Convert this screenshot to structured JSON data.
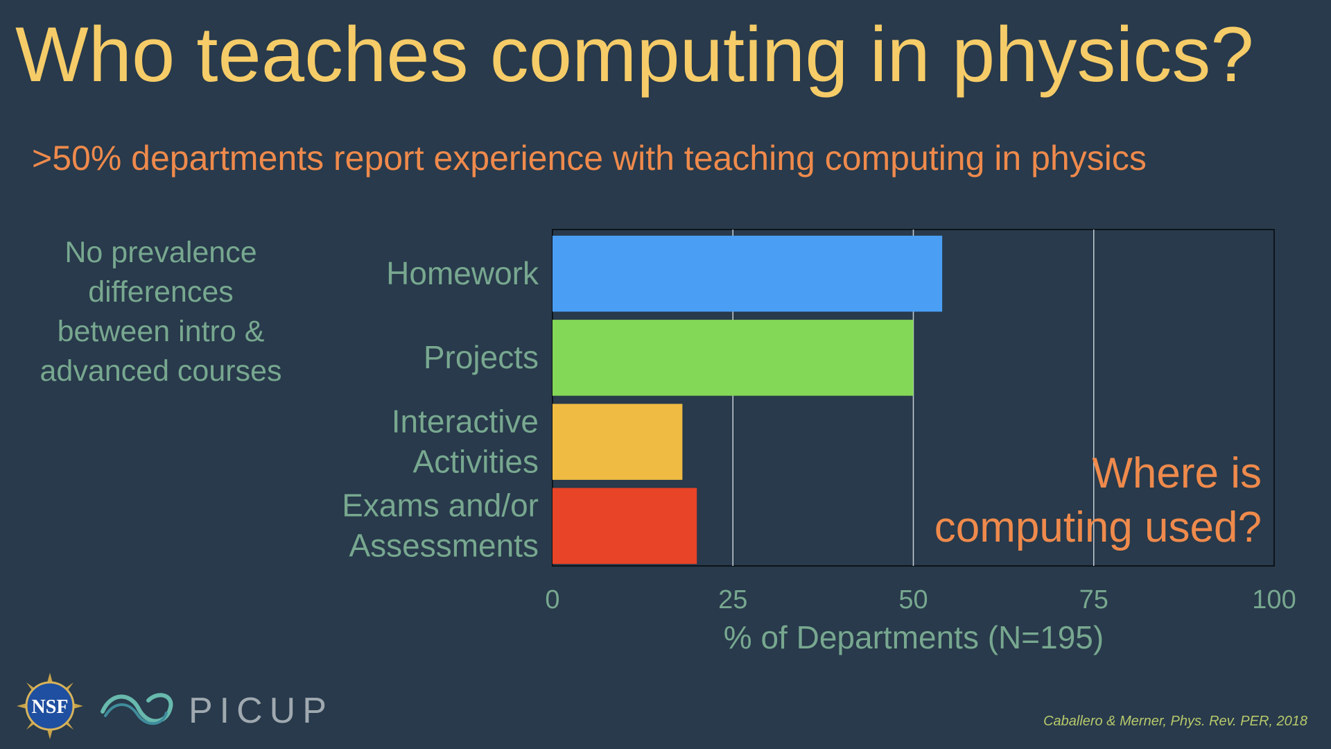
{
  "slide": {
    "title": "Who teaches computing in physics?",
    "subtitle": ">50% departments report experience with teaching computing in physics",
    "side_note": [
      "No prevalence",
      "differences",
      "between intro &",
      "advanced courses"
    ],
    "source": "Caballero & Merner, Phys. Rev. PER, 2018",
    "logos": {
      "nsf": "NSF",
      "picup": "PICUP"
    }
  },
  "colors": {
    "background": "#283a4b",
    "title": "#f6cc68",
    "accent": "#ef8a4c",
    "muted_text": "#78a890",
    "grid": "#c7cfd6"
  },
  "chart_data": {
    "type": "bar",
    "orientation": "horizontal",
    "categories": [
      [
        "Homework"
      ],
      [
        "Projects"
      ],
      [
        "Interactive",
        "Activities"
      ],
      [
        "Exams and/or",
        "Assessments"
      ]
    ],
    "values": [
      54,
      50,
      18,
      20
    ],
    "colors": [
      "#4a9ff5",
      "#84d857",
      "#efbb43",
      "#e84427"
    ],
    "xlabel": "% of Departments (N=195)",
    "xlim": [
      0,
      100
    ],
    "xticks": [
      0,
      25,
      50,
      75,
      100
    ],
    "grid": true,
    "annotation": [
      "Where is",
      "computing used?"
    ]
  }
}
